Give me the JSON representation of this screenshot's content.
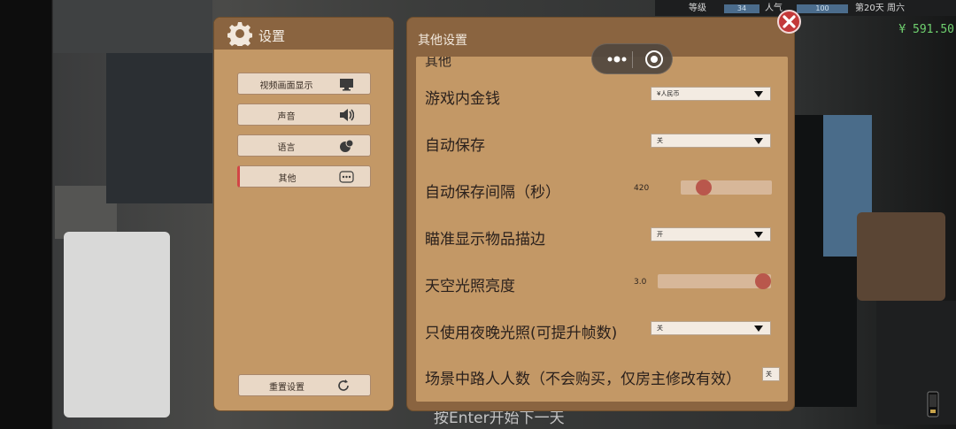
{
  "hud": {
    "level_label": "等级",
    "level_value": "34",
    "popularity_label": "人气",
    "popularity_value": "100",
    "day_label": "第20天",
    "weekday_label": "周六",
    "money": "¥ 591.50"
  },
  "bottom_hint": "按Enter开始下一天",
  "settings_panel": {
    "title": "设置",
    "menu": [
      {
        "label": "视频画面显示",
        "icon": "monitor-icon"
      },
      {
        "label": "声音",
        "icon": "speaker-icon"
      },
      {
        "label": "语言",
        "icon": "language-icon"
      },
      {
        "label": "其他",
        "icon": "more-icon",
        "active": true
      }
    ],
    "reset_label": "重置设置",
    "reset_icon": "refresh-icon"
  },
  "other_panel": {
    "title": "其他设置",
    "cut_label": "其他",
    "rows": [
      {
        "label": "游戏内金钱",
        "type": "dropdown",
        "value": "¥人民币"
      },
      {
        "label": "自动保存",
        "type": "dropdown",
        "value": "关"
      },
      {
        "label": "自动保存间隔（秒）",
        "type": "slider",
        "value": "420"
      },
      {
        "label": "瞄准显示物品描边",
        "type": "dropdown",
        "value": "开"
      },
      {
        "label": "天空光照亮度",
        "type": "slider",
        "value": "3.0"
      },
      {
        "label": "只使用夜晚光照(可提升帧数)",
        "type": "dropdown",
        "value": "关"
      },
      {
        "label": "场景中路人人数（不会购买，仅房主修改有效）",
        "type": "dropdown",
        "value": "关"
      }
    ],
    "slider_levels": {
      "autosave_interval": 0.2,
      "sky_brightness": 1.0
    }
  },
  "colors": {
    "panel_header": "#8a6440",
    "panel_body": "#c39866",
    "button_bg": "#e9d8c6",
    "active_accent": "#d24545",
    "slider_knob": "#b9574c",
    "close_button": "#c33a3a"
  }
}
